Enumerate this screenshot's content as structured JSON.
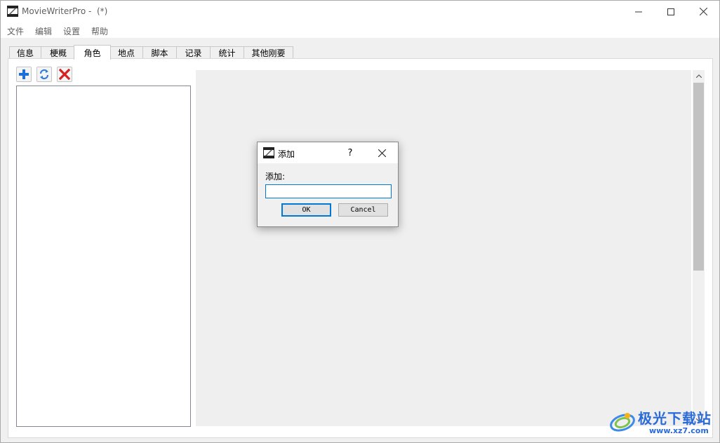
{
  "window": {
    "title": "MovieWriterPro -  (*)"
  },
  "menu": [
    "文件",
    "编辑",
    "设置",
    "帮助"
  ],
  "tabs": [
    {
      "label": "信息",
      "active": false
    },
    {
      "label": "梗概",
      "active": false
    },
    {
      "label": "角色",
      "active": true
    },
    {
      "label": "地点",
      "active": false
    },
    {
      "label": "脚本",
      "active": false
    },
    {
      "label": "记录",
      "active": false
    },
    {
      "label": "统计",
      "active": false
    },
    {
      "label": "其他刚要",
      "active": false
    }
  ],
  "toolbar": {
    "add_icon": "plus-icon",
    "refresh_icon": "refresh-icon",
    "delete_icon": "delete-x-icon",
    "colors": {
      "add": "#1e6fd9",
      "refresh": "#2f7de1",
      "delete": "#d81f1f"
    }
  },
  "dialog": {
    "title": "添加",
    "help": "?",
    "label": "添加:",
    "input_value": "",
    "ok_label": "OK",
    "cancel_label": "Cancel"
  },
  "watermark": {
    "text": "极光下载站",
    "url": "www.xz7.com"
  },
  "colors": {
    "accent": "#0078d7",
    "background": "#f0f0f0"
  }
}
